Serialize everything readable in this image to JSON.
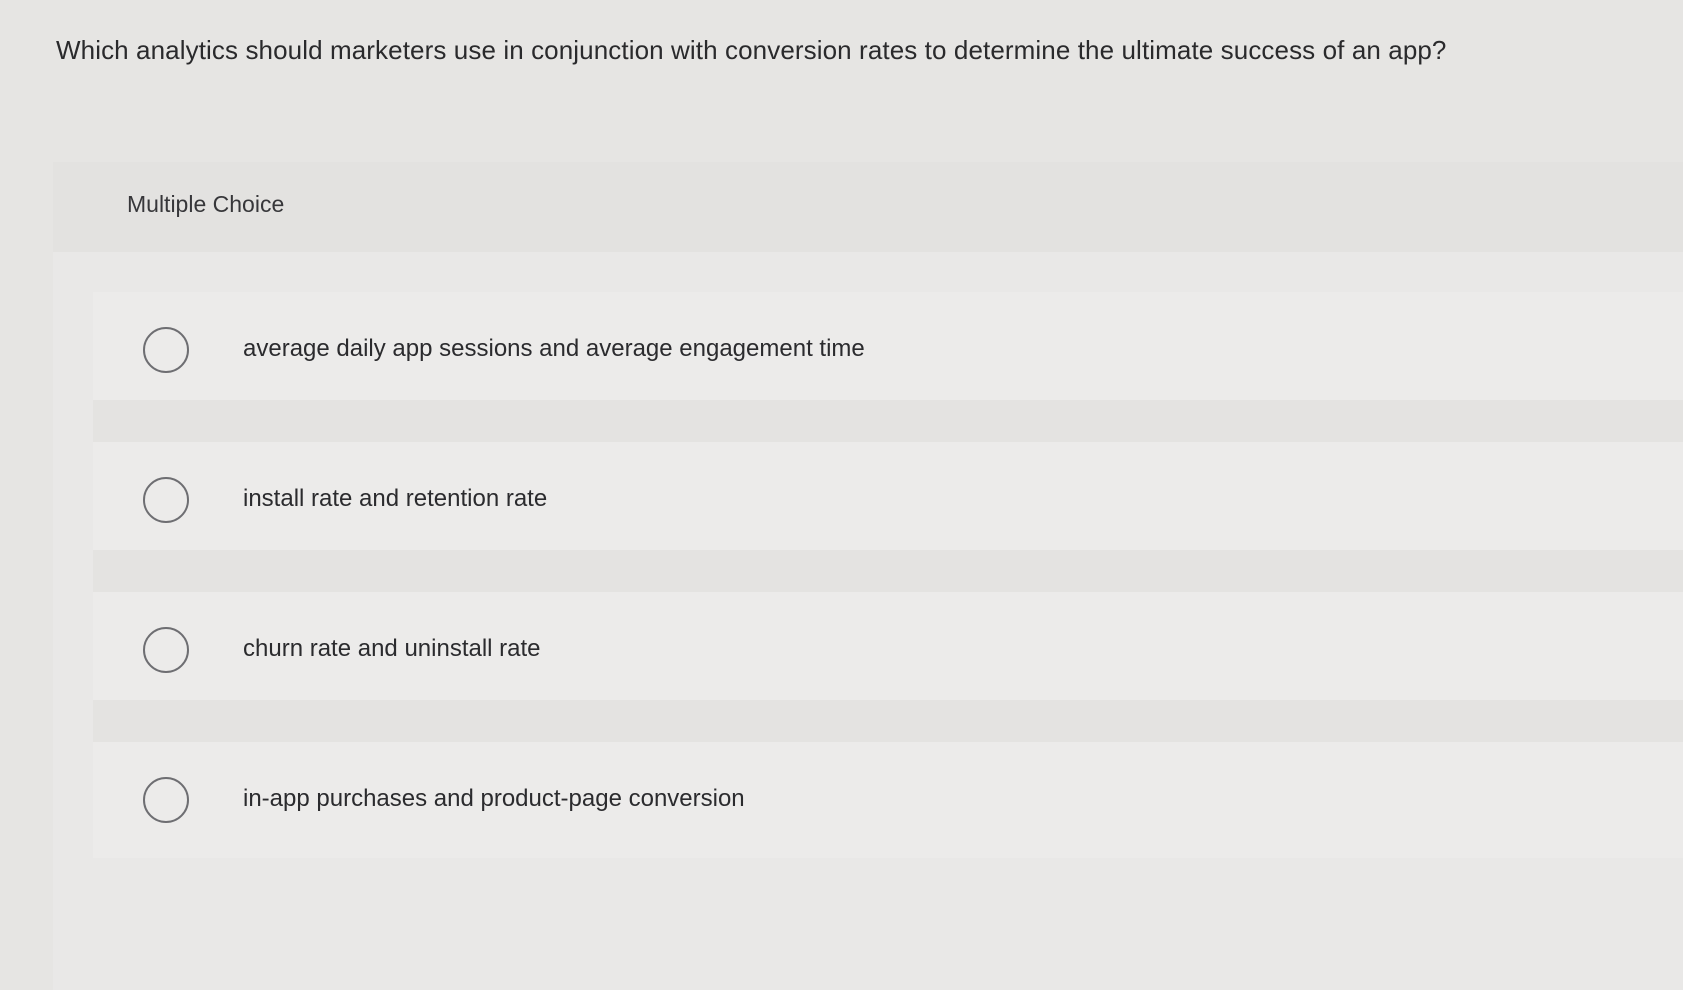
{
  "question": {
    "text": "Which analytics should marketers use in conjunction with conversion rates to determine the ultimate success of an app?"
  },
  "panel": {
    "type_label": "Multiple Choice"
  },
  "options": [
    {
      "label": "average daily app sessions and average engagement time",
      "selected": false
    },
    {
      "label": "install rate and retention rate",
      "selected": false
    },
    {
      "label": "churn rate and uninstall rate",
      "selected": false
    },
    {
      "label": "in-app purchases and product-page conversion",
      "selected": false
    }
  ],
  "icons": {
    "radio": "radio-button-empty-icon"
  },
  "colors": {
    "background": "#e6e5e3",
    "text": "#2a2a2c",
    "radio_border": "#6e6e72"
  }
}
